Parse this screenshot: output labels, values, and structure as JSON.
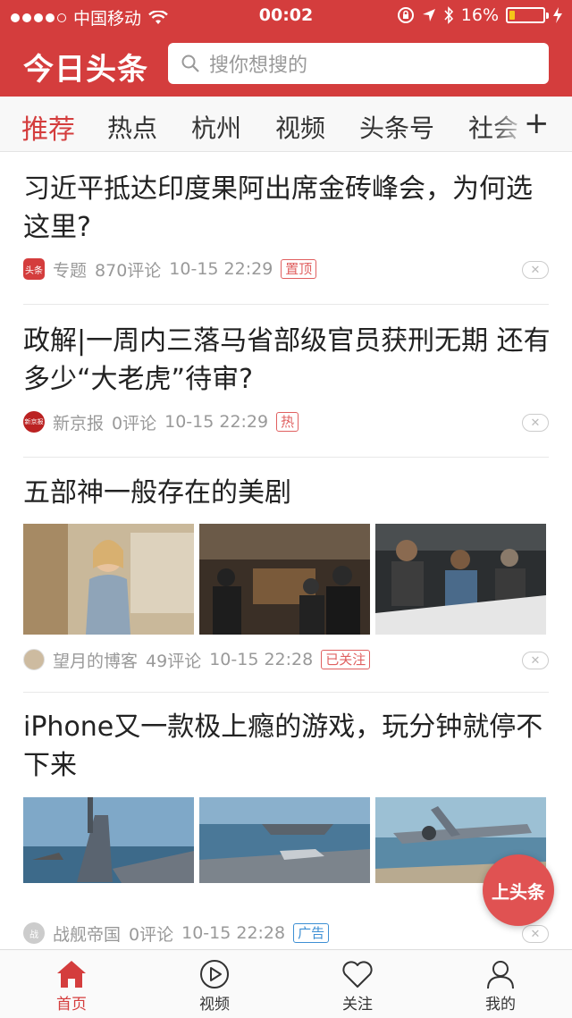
{
  "status_bar": {
    "carrier": "中国移动",
    "time": "00:02",
    "battery": "16%",
    "battery_level": 0.16
  },
  "header": {
    "logo": "今日头条",
    "search_placeholder": "搜你想搜的"
  },
  "tabs": [
    {
      "label": "推荐",
      "active": true
    },
    {
      "label": "热点"
    },
    {
      "label": "杭州"
    },
    {
      "label": "视频"
    },
    {
      "label": "头条号"
    },
    {
      "label": "社会"
    }
  ],
  "tab_add": "+",
  "feed": [
    {
      "title": "习近平抵达印度果阿出席金砖峰会，为何选这里?",
      "source": "专题",
      "source_icon_text": "头条",
      "comments": "870评论",
      "time": "10-15 22:29",
      "badge": "置顶"
    },
    {
      "title": "政解|一周内三落马省部级官员获刑无期 还有多少“大老虎”待审?",
      "source": "新京报",
      "source_icon_text": "新京报",
      "comments": "0评论",
      "time": "10-15 22:29",
      "badge": "热"
    },
    {
      "title": "五部神一般存在的美剧",
      "source": "望月的博客",
      "comments": "49评论",
      "time": "10-15 22:28",
      "badge": "已关注"
    },
    {
      "title": "iPhone又一款极上瘾的游戏，玩分钟就停不下来",
      "source": "战舰帝国",
      "source_icon_text": "战",
      "comments": "0评论",
      "time": "10-15 22:28",
      "badge": "广告"
    }
  ],
  "fab_label": "上头条",
  "bottom_nav": [
    {
      "label": "首页",
      "icon": "home-icon"
    },
    {
      "label": "视频",
      "icon": "play-icon"
    },
    {
      "label": "关注",
      "icon": "heart-icon"
    },
    {
      "label": "我的",
      "icon": "user-icon"
    }
  ],
  "colors": {
    "brand_red": "#d43d3d",
    "badge_red": "#e06060",
    "badge_blue": "#3d8fd4"
  }
}
